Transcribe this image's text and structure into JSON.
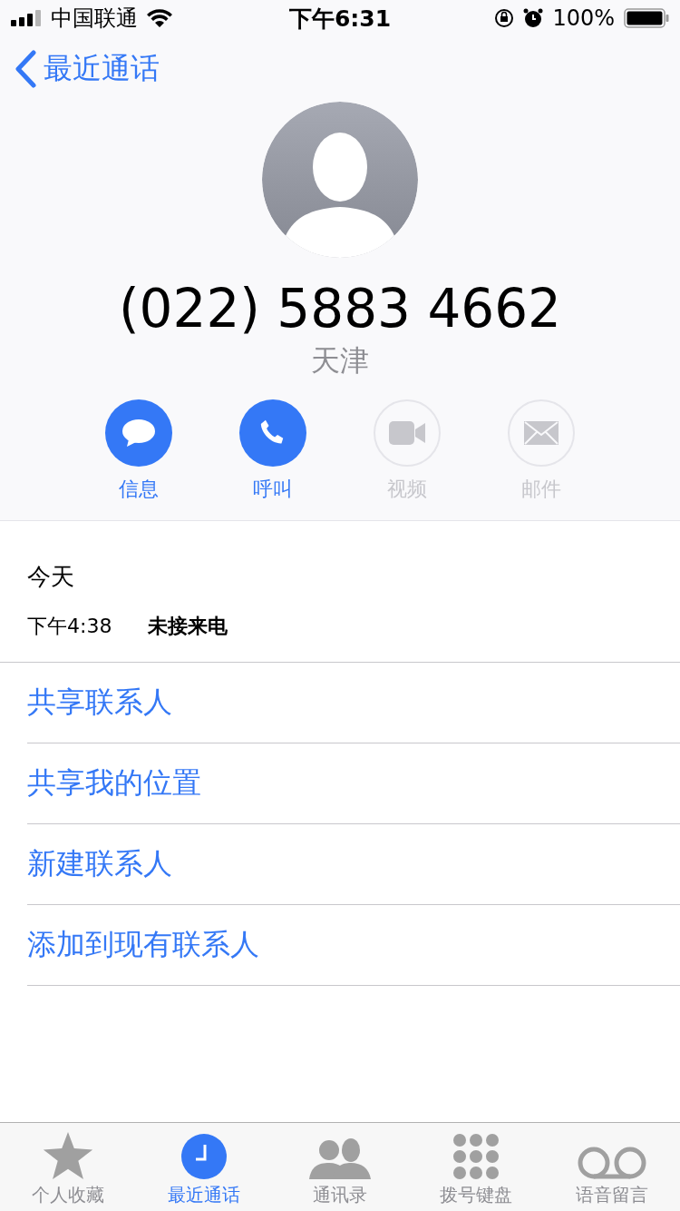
{
  "status_bar": {
    "carrier": "中国联通",
    "time": "下午6:31",
    "battery": "100%"
  },
  "nav": {
    "back_label": "最近通话"
  },
  "contact": {
    "number": "(022) 5883 4662",
    "location": "天津"
  },
  "actions": [
    {
      "kind": "message",
      "label": "信息",
      "disabled": false
    },
    {
      "kind": "call",
      "label": "呼叫",
      "disabled": false
    },
    {
      "kind": "video",
      "label": "视频",
      "disabled": true
    },
    {
      "kind": "mail",
      "label": "邮件",
      "disabled": true
    }
  ],
  "history": {
    "day": "今天",
    "entries": [
      {
        "time": "下午4:38",
        "type": "未接来电"
      }
    ]
  },
  "options": [
    "共享联系人",
    "共享我的位置",
    "新建联系人",
    "添加到现有联系人"
  ],
  "tab_bar": [
    {
      "kind": "favorites",
      "label": "个人收藏",
      "selected": false
    },
    {
      "kind": "recents",
      "label": "最近通话",
      "selected": true
    },
    {
      "kind": "contacts",
      "label": "通讯录",
      "selected": false
    },
    {
      "kind": "keypad",
      "label": "拨号键盘",
      "selected": false
    },
    {
      "kind": "voicemail",
      "label": "语音留言",
      "selected": false
    }
  ]
}
